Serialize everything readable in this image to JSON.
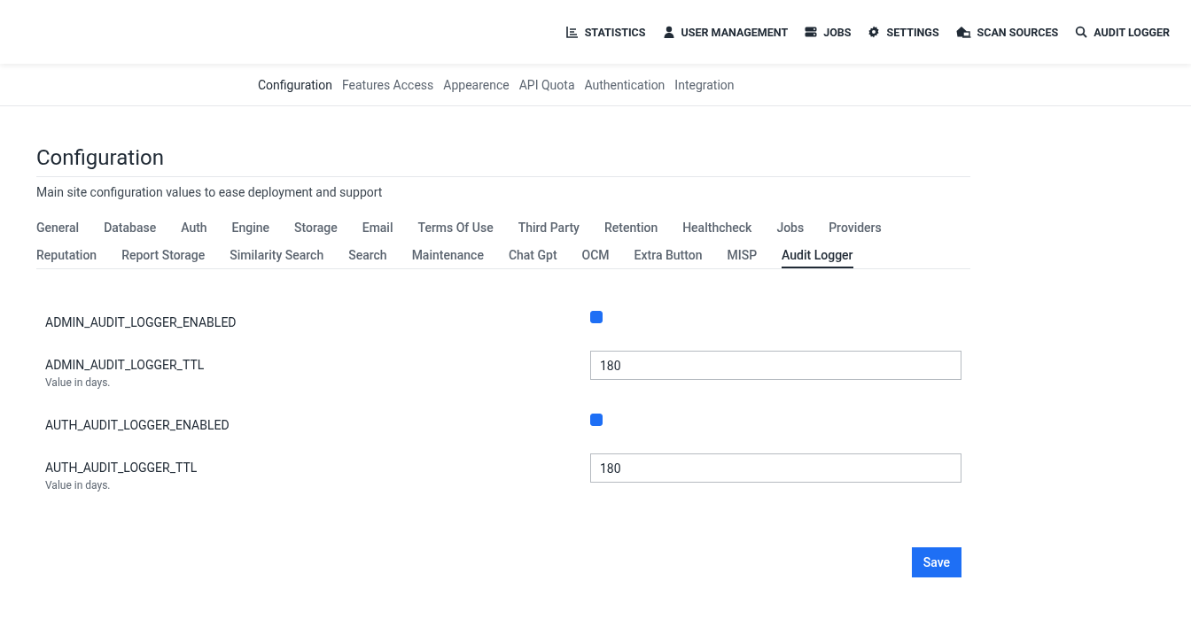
{
  "top_nav": [
    {
      "label": "STATISTICS",
      "kind": "chart"
    },
    {
      "label": "USER MANAGEMENT",
      "kind": "user"
    },
    {
      "label": "JOBS",
      "kind": "server"
    },
    {
      "label": "SETTINGS",
      "kind": "gear"
    },
    {
      "label": "SCAN SOURCES",
      "kind": "sources"
    },
    {
      "label": "AUDIT LOGGER",
      "kind": "search"
    }
  ],
  "sub_nav": [
    {
      "label": "Configuration",
      "selected": true
    },
    {
      "label": "Features Access",
      "selected": false
    },
    {
      "label": "Appearence",
      "selected": false
    },
    {
      "label": "API Quota",
      "selected": false
    },
    {
      "label": "Authentication",
      "selected": false
    },
    {
      "label": "Integration",
      "selected": false
    }
  ],
  "page": {
    "title": "Configuration",
    "description": "Main site configuration values to ease deployment and support"
  },
  "tabs": [
    {
      "label": "General",
      "selected": false
    },
    {
      "label": "Database",
      "selected": false
    },
    {
      "label": "Auth",
      "selected": false
    },
    {
      "label": "Engine",
      "selected": false
    },
    {
      "label": "Storage",
      "selected": false
    },
    {
      "label": "Email",
      "selected": false
    },
    {
      "label": "Terms Of Use",
      "selected": false
    },
    {
      "label": "Third Party",
      "selected": false
    },
    {
      "label": "Retention",
      "selected": false
    },
    {
      "label": "Healthcheck",
      "selected": false
    },
    {
      "label": "Jobs",
      "selected": false
    },
    {
      "label": "Providers",
      "selected": false
    },
    {
      "label": "Reputation",
      "selected": false
    },
    {
      "label": "Report Storage",
      "selected": false
    },
    {
      "label": "Similarity Search",
      "selected": false
    },
    {
      "label": "Search",
      "selected": false
    },
    {
      "label": "Maintenance",
      "selected": false
    },
    {
      "label": "Chat Gpt",
      "selected": false
    },
    {
      "label": "OCM",
      "selected": false
    },
    {
      "label": "Extra Button",
      "selected": false
    },
    {
      "label": "MISP",
      "selected": false
    },
    {
      "label": "Audit Logger",
      "selected": true
    }
  ],
  "settings": [
    {
      "kind": "checkbox",
      "name": "ADMIN_AUDIT_LOGGER_ENABLED",
      "checked": true
    },
    {
      "kind": "number",
      "name": "ADMIN_AUDIT_LOGGER_TTL",
      "value": "180",
      "help": "Value in days."
    },
    {
      "kind": "checkbox",
      "name": "AUTH_AUDIT_LOGGER_ENABLED",
      "checked": true
    },
    {
      "kind": "number",
      "name": "AUTH_AUDIT_LOGGER_TTL",
      "value": "180",
      "help": "Value in days."
    }
  ],
  "save_button": "Save"
}
